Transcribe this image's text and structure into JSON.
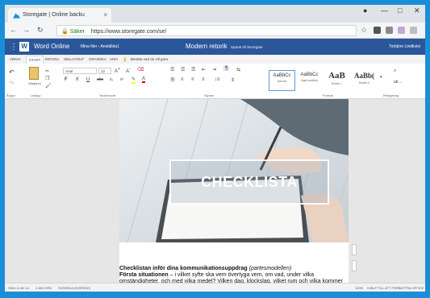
{
  "browser": {
    "tab_title": "Storegate | Online backu",
    "secure_label": "Säker",
    "url": "https://www.storegate.com/se/"
  },
  "app": {
    "name": "Word Online",
    "breadcrumb": "Mina filer › Anställda1",
    "document_title": "Modern retorik",
    "saved_status": "Sparat till Storegate",
    "user": "Torbjörn Lindkvist"
  },
  "ribbon": {
    "tabs": [
      "ARKIV",
      "START",
      "INFOGA",
      "SIDLAYOUT",
      "GRANSKA",
      "VISA"
    ],
    "tell_me": "Berätta vad du vill göra",
    "paste_label": "Klistra in",
    "font_name": "Arial",
    "font_size": "12",
    "groups": [
      "Ångra",
      "Urklipp",
      "Teckensnitt",
      "Stycke",
      "Format",
      "Redigering"
    ],
    "styles": [
      {
        "sample": "AaBbCc",
        "name": "Normal"
      },
      {
        "sample": "AaBbCc",
        "name": "Inget avstånd"
      },
      {
        "sample": "AaB",
        "name": "Rubrik 1"
      },
      {
        "sample": "AaBb(",
        "name": "Rubrik 2"
      }
    ]
  },
  "document": {
    "banner_text": "CHECKLISTA",
    "heading": "Checklistan inför dina kommunikationsuppdrag",
    "heading_note": "(partesmodellen)",
    "subheading": "Första situationen",
    "body": " – i vilket syfte ska vem övertyga vem, om vad, under vilka omständigheter, och med vilka medel? Vilken dag, klockslag, vilket rum och vilka kommer att vara där?"
  },
  "statusbar": {
    "page": "SIDA 11 AV 14",
    "words": "1 463 ORD",
    "language": "SVENSKA (SVERIGE)",
    "zoom": "100%",
    "help": "HJÄLP TILL ATT FÖRBÄTTRA OFFICE"
  },
  "colors": {
    "desktop": "#1a8fd8",
    "word_blue": "#2b579a"
  }
}
